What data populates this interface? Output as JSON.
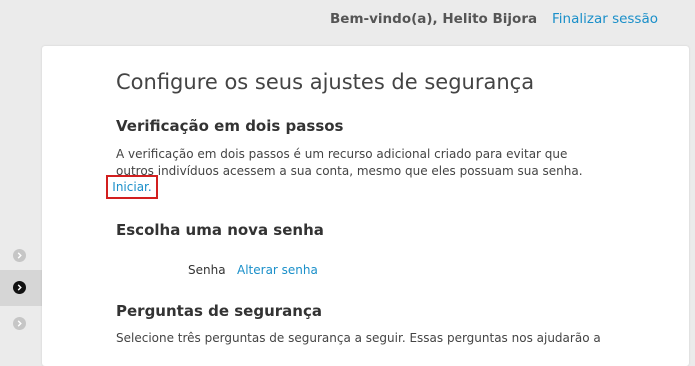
{
  "header": {
    "welcome_text": "Bem-vindo(a), Helito Bijora",
    "logout_label": "Finalizar sessão"
  },
  "main": {
    "title": "Configure os seus ajustes de segurança",
    "two_step": {
      "heading": "Verificação em dois passos",
      "description": "A verificação em dois passos é um recurso adicional criado para evitar que outros indivíduos acessem a sua conta, mesmo que eles possuam sua senha.",
      "start_label": "Iniciar."
    },
    "new_password": {
      "heading": "Escolha uma nova senha",
      "field_label": "Senha",
      "change_label": "Alterar senha"
    },
    "security_questions": {
      "heading": "Perguntas de segurança",
      "description": "Selecione três perguntas de segurança a seguir. Essas perguntas nos ajudarão a"
    }
  },
  "colors": {
    "link": "#1a8fc9",
    "highlight_border": "#d21f1f",
    "background": "#ebebeb"
  }
}
